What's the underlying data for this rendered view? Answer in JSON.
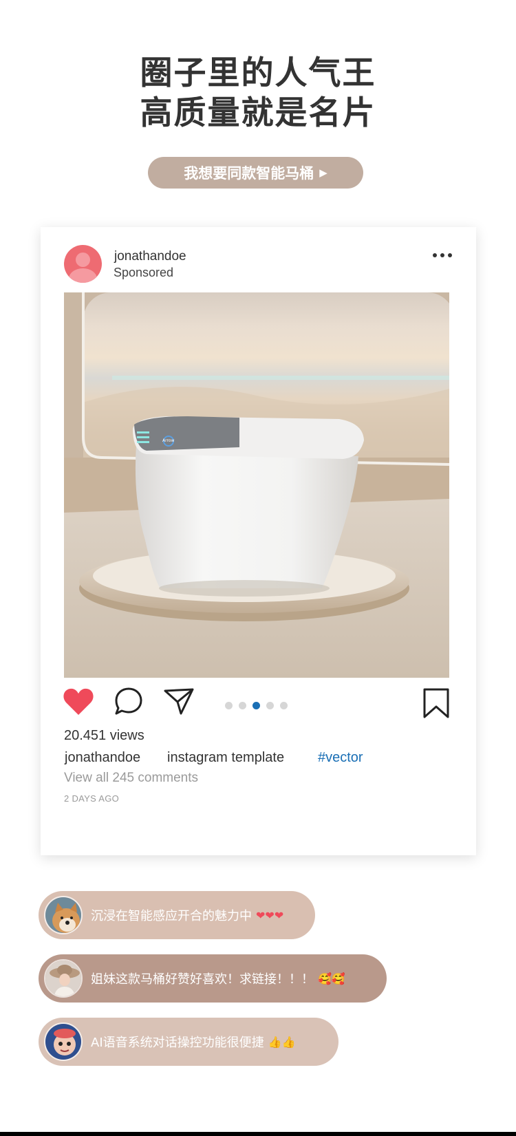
{
  "headline": {
    "line1": "圈子里的人气王",
    "line2": "高质量就是名片"
  },
  "cta": {
    "label": "我想要同款智能马桶",
    "arrow": "▶",
    "color": "#c1ada0"
  },
  "post": {
    "username": "jonathandoe",
    "sponsored": "Sponsored",
    "more_icon": "more-horizontal-icon",
    "photo": {
      "subject": "white smart toilet on round pedestal",
      "lid_label": "Arrow"
    },
    "actions": {
      "like_icon": "heart-icon",
      "like_color": "#ef4a5a",
      "comment_icon": "comment-icon",
      "share_icon": "send-icon",
      "save_icon": "bookmark-icon"
    },
    "carousel": {
      "count": 5,
      "active_index": 2,
      "active_color": "#1a6fb5"
    },
    "views": "20.451 views",
    "caption": {
      "user": "jonathandoe",
      "text": "instagram template",
      "hashtag": "#vector"
    },
    "view_all": "View all 245 comments",
    "time_ago": "2 DAYS AGO"
  },
  "comments": [
    {
      "text": "沉浸在智能感应开合的魅力中",
      "emoji": "❤❤❤",
      "avatar": "shiba-dog-avatar"
    },
    {
      "text": "姐妹这款马桶好赞好喜欢！求链接！！！",
      "emoji": "🥰🥰",
      "avatar": "girl-with-hat-avatar"
    },
    {
      "text": "AI语音系统对话操控功能很便捷",
      "emoji": "👍👍",
      "avatar": "cartoon-avatar"
    }
  ]
}
